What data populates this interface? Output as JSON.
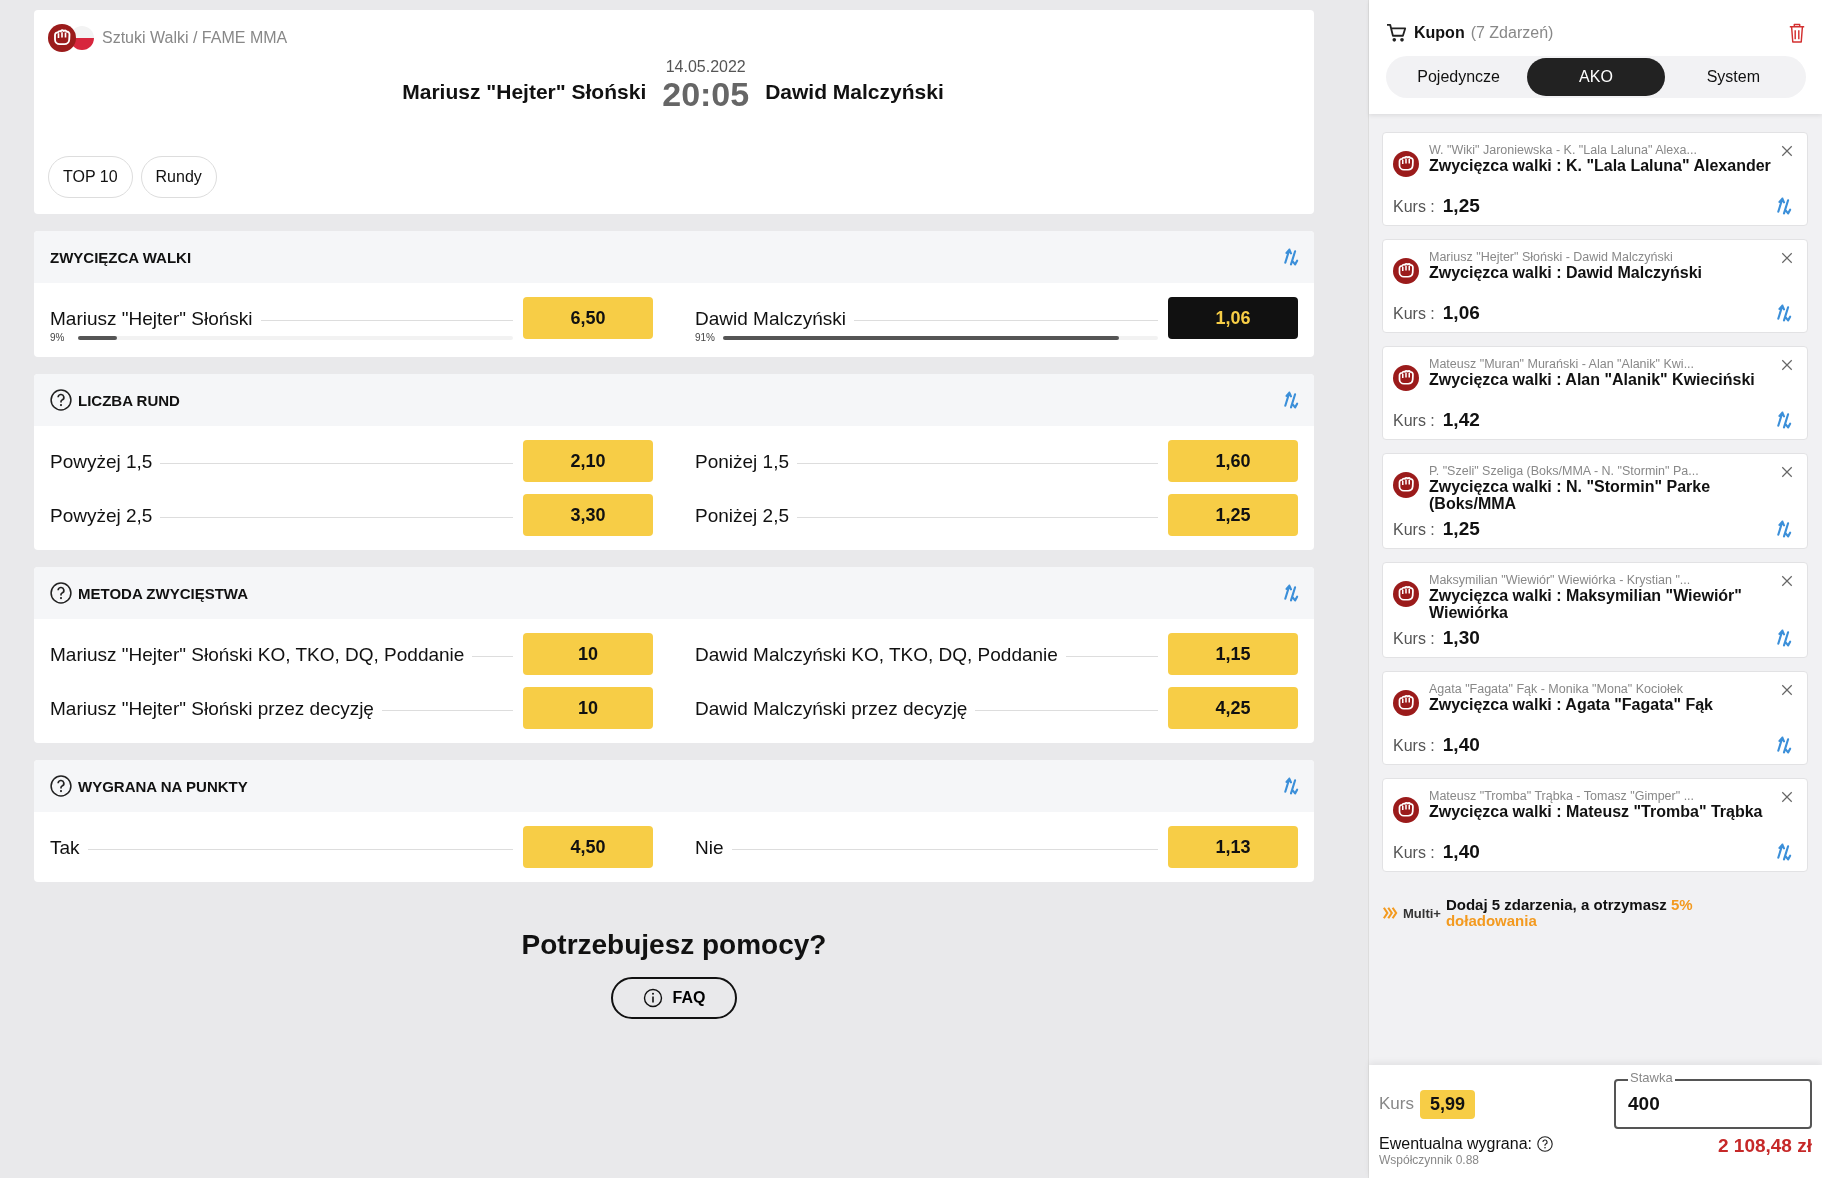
{
  "event": {
    "breadcrumb": "Sztuki Walki / FAME MMA",
    "home": "Mariusz \"Hejter\" Słoński",
    "date": "14.05.2022",
    "time": "20:05",
    "away": "Dawid Malczyński",
    "filters": [
      {
        "label": "TOP 10",
        "selected": false
      },
      {
        "label": "Rundy",
        "selected": false
      }
    ]
  },
  "markets": [
    {
      "title": "ZWYCIĘZCA WALKI",
      "help": false,
      "rows": [
        [
          {
            "label": "Mariusz \"Hejter\" Słoński",
            "odds": "6,50",
            "selected": false,
            "percent": "9%",
            "level": 0.09
          },
          {
            "label": "Dawid Malczyński",
            "odds": "1,06",
            "selected": true,
            "percent": "91%",
            "level": 0.91
          }
        ]
      ]
    },
    {
      "title": "LICZBA RUND",
      "help": true,
      "rows": [
        [
          {
            "label": "Powyżej 1,5",
            "odds": "2,10",
            "selected": false
          },
          {
            "label": "Poniżej 1,5",
            "odds": "1,60",
            "selected": false
          }
        ],
        [
          {
            "label": "Powyżej 2,5",
            "odds": "3,30",
            "selected": false
          },
          {
            "label": "Poniżej 2,5",
            "odds": "1,25",
            "selected": false
          }
        ]
      ]
    },
    {
      "title": "METODA ZWYCIĘSTWA",
      "help": true,
      "rows": [
        [
          {
            "label": "Mariusz \"Hejter\" Słoński KO, TKO, DQ, Poddanie",
            "odds": "10",
            "selected": false
          },
          {
            "label": "Dawid Malczyński KO, TKO, DQ, Poddanie",
            "odds": "1,15",
            "selected": false
          }
        ],
        [
          {
            "label": "Mariusz \"Hejter\" Słoński przez decyzję",
            "odds": "10",
            "selected": false
          },
          {
            "label": "Dawid Malczyński przez decyzję",
            "odds": "4,25",
            "selected": false
          }
        ]
      ]
    },
    {
      "title": "WYGRANA NA PUNKTY",
      "help": true,
      "rows": [
        [
          {
            "label": "Tak",
            "odds": "4,50",
            "selected": false
          },
          {
            "label": "Nie",
            "odds": "1,13",
            "selected": false
          }
        ]
      ]
    }
  ],
  "help": {
    "title": "Potrzebujesz pomocy?",
    "button": "FAQ"
  },
  "coupon": {
    "title": "Kupon",
    "count": "(7 Zdarzeń)",
    "tabs": [
      {
        "label": "Pojedyncze",
        "selected": false
      },
      {
        "label": "AKO",
        "selected": true
      },
      {
        "label": "System",
        "selected": false
      }
    ],
    "bets": [
      {
        "event": "W. \"Wiki\" Jaroniewska - K. \"Lala Laluna\" Alexa...",
        "pick": "Zwycięzca walki : K. \"Lala Laluna\" Alexander",
        "odds_label": "Kurs :",
        "odds": "1,25"
      },
      {
        "event": "Mariusz \"Hejter\" Słoński - Dawid Malczyński",
        "pick": "Zwycięzca walki : Dawid Malczyński",
        "odds_label": "Kurs :",
        "odds": "1,06"
      },
      {
        "event": "Mateusz \"Muran\" Murański - Alan \"Alanik\" Kwi...",
        "pick": "Zwycięzca walki : Alan \"Alanik\" Kwieciński",
        "odds_label": "Kurs :",
        "odds": "1,42"
      },
      {
        "event": "P. \"Szeli\" Szeliga (Boks/MMA - N. \"Stormin\" Pa...",
        "pick": "Zwycięzca walki : N. \"Stormin\" Parke (Boks/MMA",
        "odds_label": "Kurs :",
        "odds": "1,25"
      },
      {
        "event": "Maksymilian \"Wiewiór\" Wiewiórka - Krystian \"...",
        "pick": "Zwycięzca walki : Maksymilian \"Wiewiór\" Wiewiórka",
        "odds_label": "Kurs :",
        "odds": "1,30"
      },
      {
        "event": "Agata \"Fagata\" Fąk - Monika \"Mona\" Kociołek",
        "pick": "Zwycięzca walki : Agata \"Fagata\" Fąk",
        "odds_label": "Kurs :",
        "odds": "1,40"
      },
      {
        "event": "Mateusz \"Tromba\" Trąbka - Tomasz \"Gimper\" ...",
        "pick": "Zwycięzca walki : Mateusz \"Tromba\" Trąbka",
        "odds_label": "Kurs :",
        "odds": "1,40"
      }
    ],
    "promo": {
      "label": "Multi+",
      "text": "Dodaj 5 zdarzenia, a otrzymasz ",
      "highlight": "5% doładowania"
    },
    "footer": {
      "odds_label": "Kurs",
      "odds": "5,99",
      "stake_label": "Stawka",
      "stake": "400",
      "win_label": "Ewentualna wygrana:",
      "coefficient": "Współczynnik 0.88",
      "win": "2 108,48 zł"
    }
  }
}
